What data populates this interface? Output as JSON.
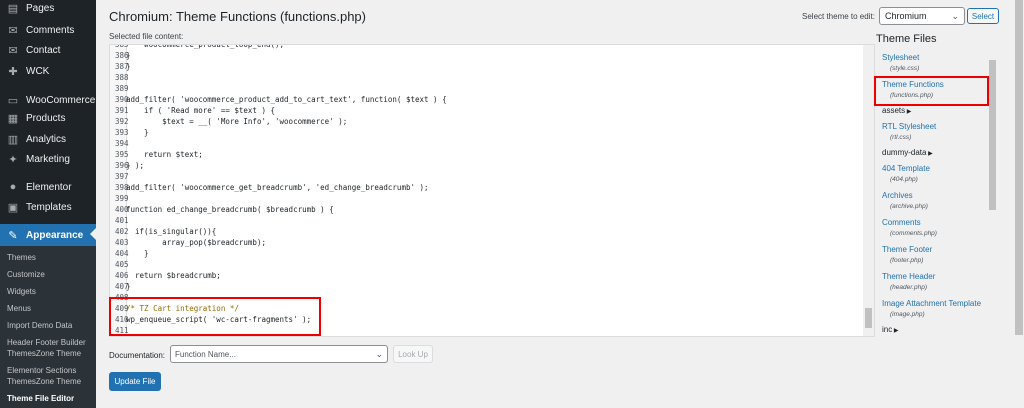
{
  "sidebar": {
    "items": [
      {
        "label": "Pages",
        "icon": "pages-icon",
        "glyph": "▤"
      },
      {
        "label": "Comments",
        "icon": "comments-icon",
        "glyph": "✉"
      },
      {
        "label": "Contact",
        "icon": "contact-icon",
        "glyph": "✉"
      },
      {
        "label": "WCK",
        "icon": "wck-icon",
        "glyph": "✚"
      },
      {
        "label": "WooCommerce",
        "icon": "woocommerce-icon",
        "glyph": "▭"
      },
      {
        "label": "Products",
        "icon": "products-icon",
        "glyph": "▦"
      },
      {
        "label": "Analytics",
        "icon": "analytics-icon",
        "glyph": "▥"
      },
      {
        "label": "Marketing",
        "icon": "marketing-icon",
        "glyph": "✦"
      },
      {
        "label": "Elementor",
        "icon": "elementor-icon",
        "glyph": "●"
      },
      {
        "label": "Templates",
        "icon": "templates-icon",
        "glyph": "▣"
      },
      {
        "label": "Appearance",
        "icon": "appearance-icon",
        "glyph": "✎"
      }
    ],
    "submenu": [
      "Themes",
      "Customize",
      "Widgets",
      "Menus",
      "Import Demo Data",
      "Header Footer Builder ThemesZone Theme",
      "Elementor Sections ThemesZone Theme",
      "Theme File Editor"
    ]
  },
  "header": {
    "title": "Chromium: Theme Functions (functions.php)",
    "selected_label": "Selected file content:",
    "theme_select_label": "Select theme to edit:",
    "theme_select_value": "Chromium",
    "select_button": "Select"
  },
  "editor": {
    "lines": [
      {
        "n": "385",
        "code": "    woocommerce_product_loop_end();"
      },
      {
        "n": "386",
        "code": "}"
      },
      {
        "n": "387",
        "code": "}"
      },
      {
        "n": "388",
        "code": ""
      },
      {
        "n": "389",
        "code": ""
      },
      {
        "n": "390",
        "code": "add_filter( 'woocommerce_product_add_to_cart_text', function( $text ) {"
      },
      {
        "n": "391",
        "code": "    if ( 'Read more' == $text ) {"
      },
      {
        "n": "392",
        "code": "        $text = __( 'More Info', 'woocommerce' );"
      },
      {
        "n": "393",
        "code": "    }"
      },
      {
        "n": "394",
        "code": ""
      },
      {
        "n": "395",
        "code": "    return $text;"
      },
      {
        "n": "396",
        "code": "} );"
      },
      {
        "n": "397",
        "code": ""
      },
      {
        "n": "398",
        "code": "add_filter( 'woocommerce_get_breadcrumb', 'ed_change_breadcrumb' );"
      },
      {
        "n": "399",
        "code": ""
      },
      {
        "n": "400",
        "code": "function ed_change_breadcrumb( $breadcrumb ) {"
      },
      {
        "n": "401",
        "code": ""
      },
      {
        "n": "402",
        "code": "  if(is_singular()){"
      },
      {
        "n": "403",
        "code": "        array_pop($breadcrumb);"
      },
      {
        "n": "404",
        "code": "    }"
      },
      {
        "n": "405",
        "code": ""
      },
      {
        "n": "406",
        "code": "  return $breadcrumb;"
      },
      {
        "n": "407",
        "code": "}"
      },
      {
        "n": "408",
        "code": ""
      },
      {
        "n": "409",
        "code": "/* TZ Cart integration */"
      },
      {
        "n": "410",
        "code": "wp_enqueue_script( 'wc-cart-fragments' );"
      },
      {
        "n": "411",
        "code": ""
      }
    ]
  },
  "files": {
    "title": "Theme Files",
    "list": [
      {
        "type": "file",
        "name": "Stylesheet",
        "file": "(style.css)"
      },
      {
        "type": "file",
        "name": "Theme Functions",
        "file": "(functions.php)"
      },
      {
        "type": "folder",
        "name": "assets"
      },
      {
        "type": "file",
        "name": "RTL Stylesheet",
        "file": "(rtl.css)"
      },
      {
        "type": "folder",
        "name": "dummy-data"
      },
      {
        "type": "file",
        "name": "404 Template",
        "file": "(404.php)"
      },
      {
        "type": "file",
        "name": "Archives",
        "file": "(archive.php)"
      },
      {
        "type": "file",
        "name": "Comments",
        "file": "(comments.php)"
      },
      {
        "type": "file",
        "name": "Theme Footer",
        "file": "(footer.php)"
      },
      {
        "type": "file",
        "name": "Theme Header",
        "file": "(header.php)"
      },
      {
        "type": "file",
        "name": "Image Attachment Template",
        "file": "(image.php)"
      },
      {
        "type": "folder",
        "name": "inc"
      }
    ]
  },
  "footer": {
    "doc_label": "Documentation:",
    "doc_placeholder": "Function Name...",
    "lookup_button": "Look Up",
    "update_button": "Update File"
  },
  "colors": {
    "accent": "#2271b1",
    "sidebar_bg": "#1d2327",
    "highlight": "#e00000"
  }
}
